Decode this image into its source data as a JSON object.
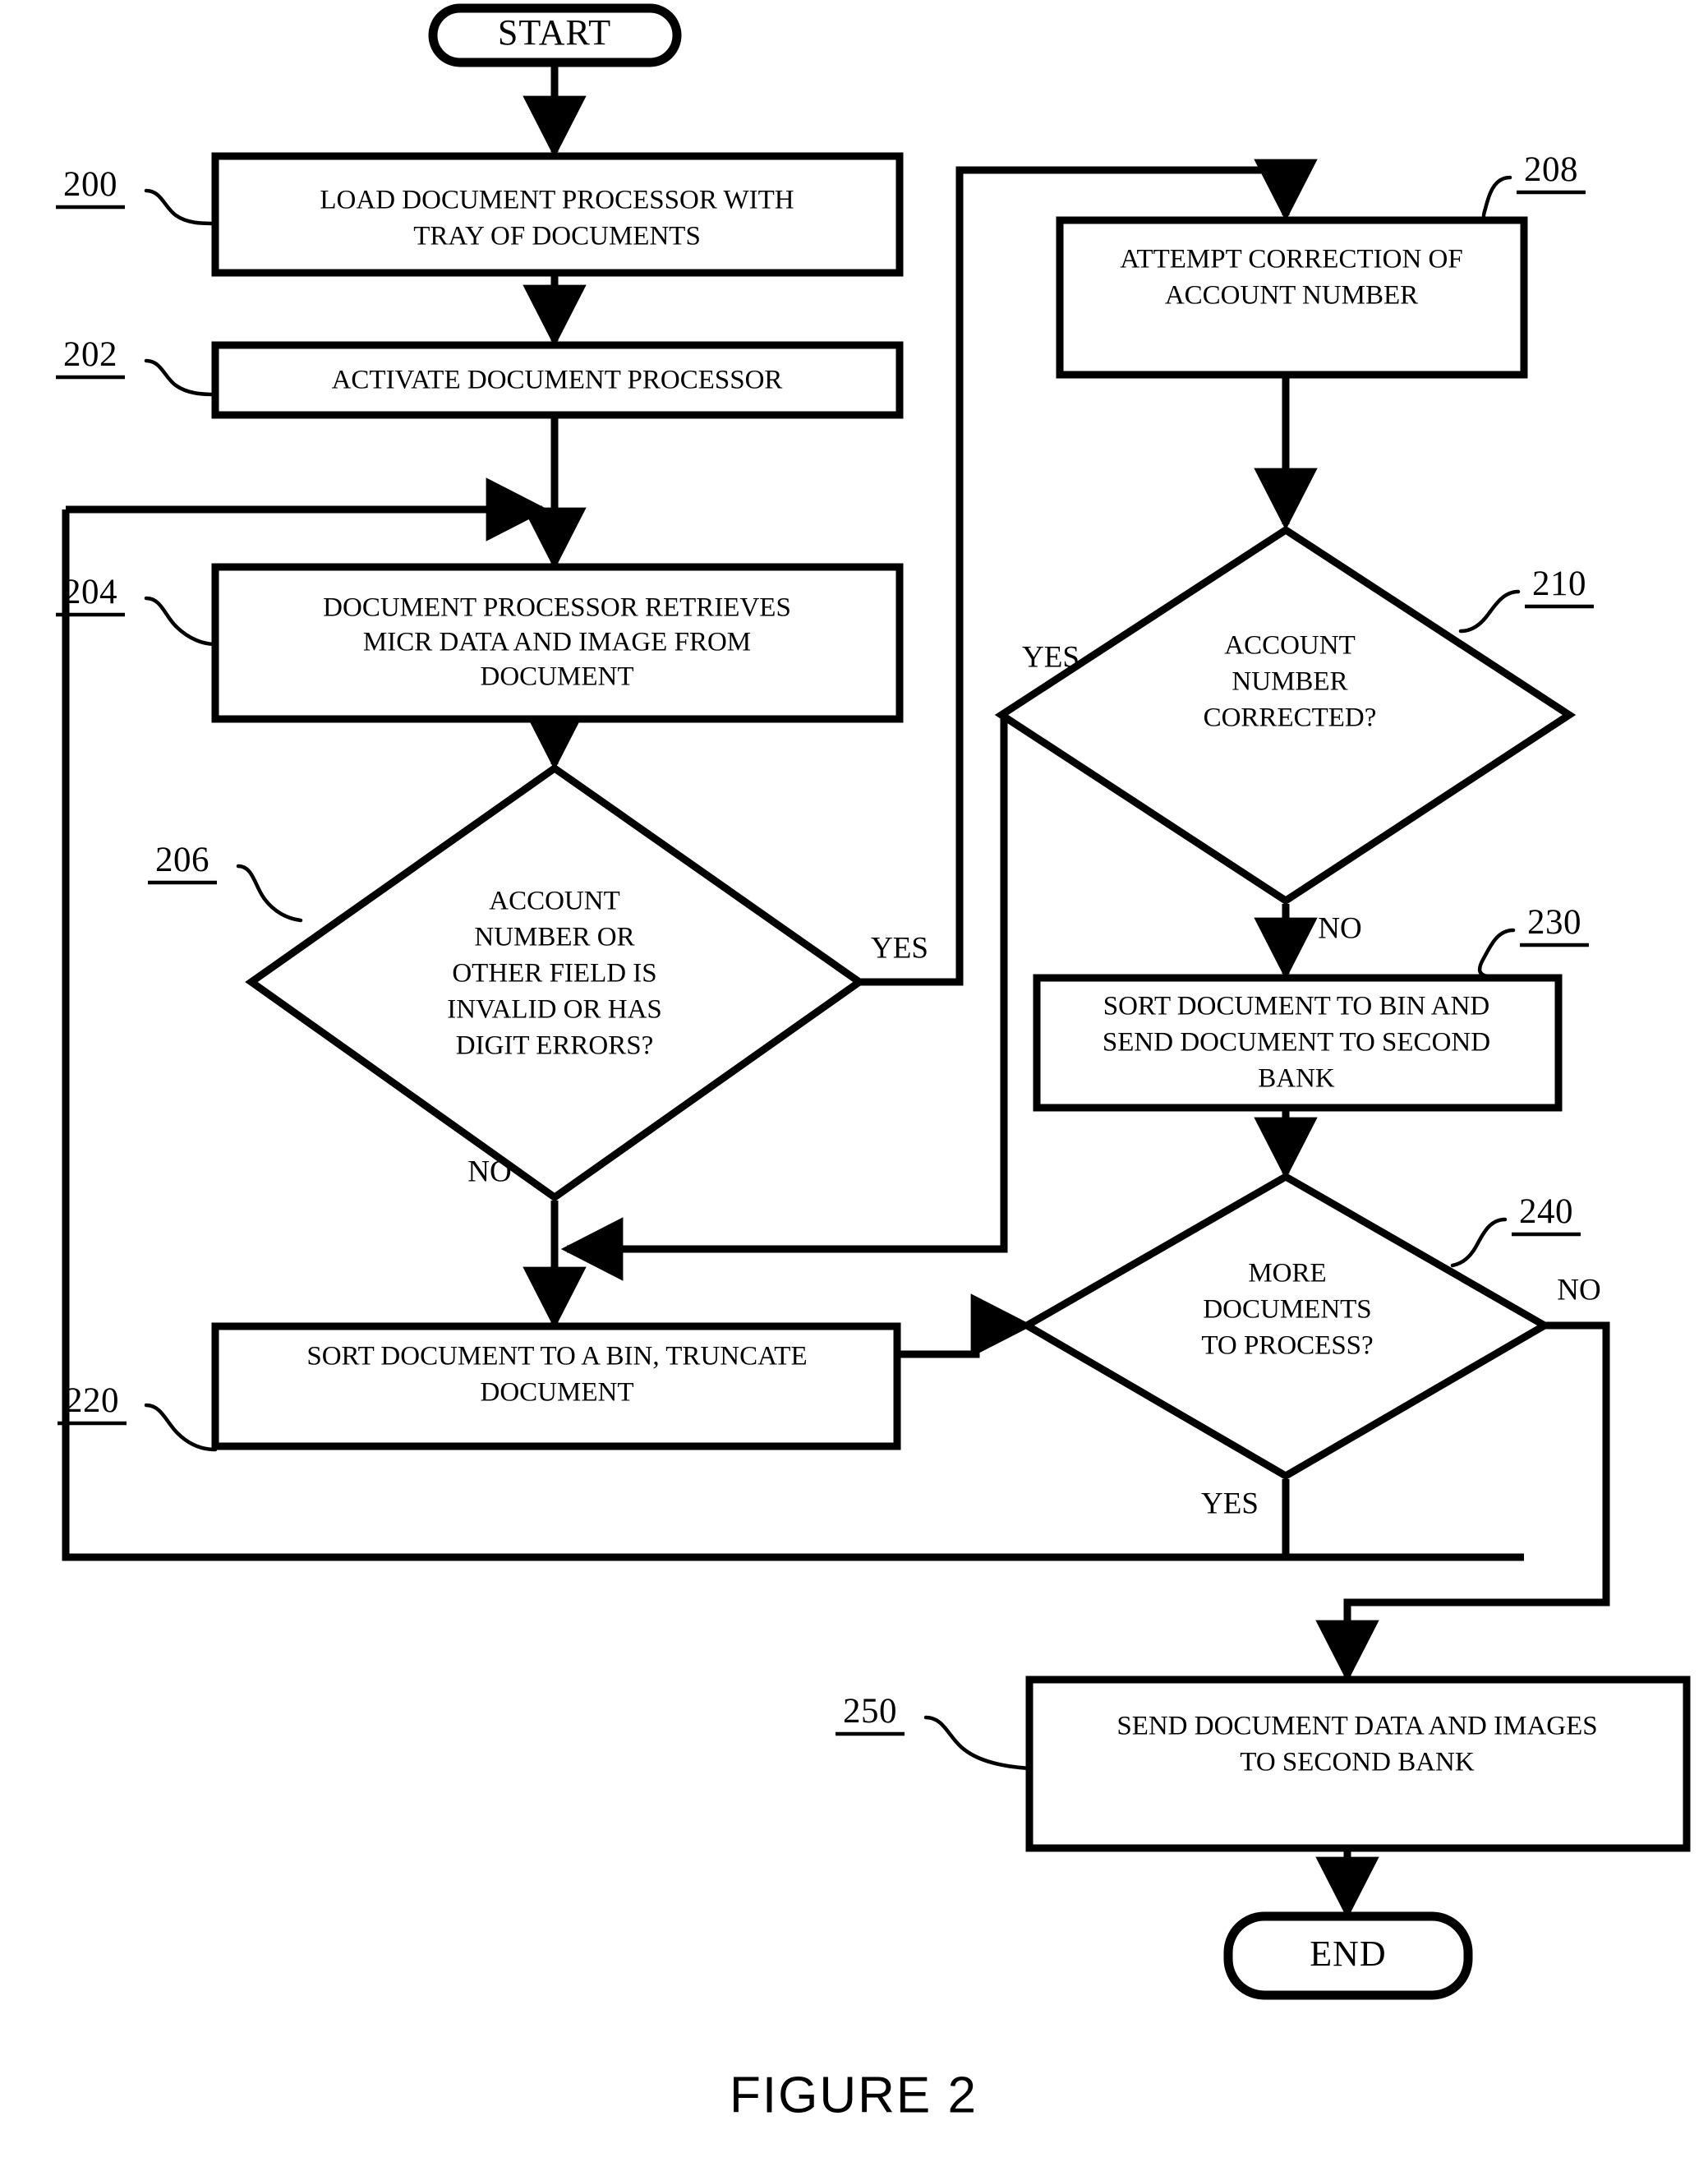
{
  "figure": {
    "caption": "FIGURE 2"
  },
  "terminators": {
    "start": "START",
    "end": "END"
  },
  "nodes": [
    {
      "ref": "200",
      "type": "process",
      "lines": [
        "LOAD DOCUMENT PROCESSOR WITH",
        "TRAY OF DOCUMENTS"
      ]
    },
    {
      "ref": "202",
      "type": "process",
      "lines": [
        "ACTIVATE DOCUMENT PROCESSOR"
      ]
    },
    {
      "ref": "204",
      "type": "process",
      "lines": [
        "DOCUMENT PROCESSOR RETRIEVES",
        "MICR DATA AND IMAGE FROM",
        "DOCUMENT"
      ]
    },
    {
      "ref": "206",
      "type": "decision",
      "lines": [
        "ACCOUNT",
        "NUMBER OR",
        "OTHER FIELD IS",
        "INVALID OR HAS",
        "DIGIT ERRORS?"
      ]
    },
    {
      "ref": "208",
      "type": "process",
      "lines": [
        "ATTEMPT CORRECTION OF",
        "ACCOUNT NUMBER"
      ]
    },
    {
      "ref": "210",
      "type": "decision",
      "lines": [
        "ACCOUNT",
        "NUMBER",
        "CORRECTED?"
      ]
    },
    {
      "ref": "220",
      "type": "process",
      "lines": [
        "SORT DOCUMENT TO A BIN, TRUNCATE",
        "DOCUMENT"
      ]
    },
    {
      "ref": "230",
      "type": "process",
      "lines": [
        "SORT DOCUMENT TO BIN AND",
        "SEND DOCUMENT TO SECOND",
        "BANK"
      ]
    },
    {
      "ref": "240",
      "type": "decision",
      "lines": [
        "MORE",
        "DOCUMENTS",
        "TO PROCESS?"
      ]
    },
    {
      "ref": "250",
      "type": "process",
      "lines": [
        "SEND DOCUMENT DATA AND IMAGES",
        "TO SECOND BANK"
      ]
    }
  ],
  "branch_labels": {
    "d206_yes": "YES",
    "d206_no": "NO",
    "d210_yes": "YES",
    "d210_no": "NO",
    "d240_yes": "YES",
    "d240_no": "NO"
  },
  "colors": {
    "stroke": "#000000",
    "fill": "#ffffff"
  }
}
